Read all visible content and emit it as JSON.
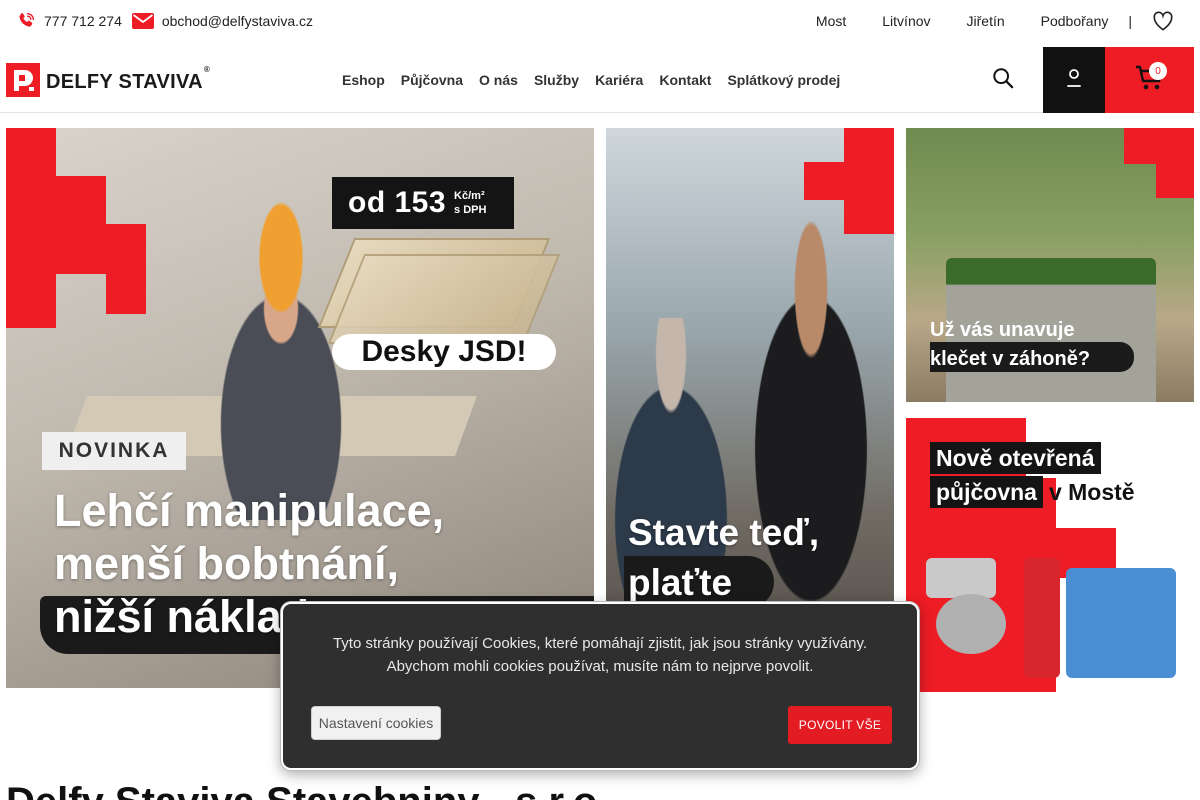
{
  "topbar": {
    "phone": "777 712 274",
    "email": "obchod@delfystaviva.cz",
    "branches": [
      "Most",
      "Litvínov",
      "Jiřetín",
      "Podbořany"
    ],
    "separator": "|"
  },
  "header": {
    "logo_text": "DELFY STAVIVA",
    "logo_reg": "®",
    "nav": [
      "Eshop",
      "Půjčovna",
      "O nás",
      "Služby",
      "Kariéra",
      "Kontakt",
      "Splátkový prodej"
    ],
    "cart_count": "0"
  },
  "banners": {
    "b1": {
      "price_main": "od 153",
      "price_unit_1": "Kč/m²",
      "price_unit_2": "s DPH",
      "product": "Desky JSD!",
      "badge": "NOVINKA",
      "headline": [
        "Lehčí manipulace,",
        "menší bobtnání,",
        "nižší náklady"
      ]
    },
    "b2": {
      "headline": [
        "Stavte teď,",
        "plaťte"
      ]
    },
    "b3": {
      "headline": [
        "Už vás unavuje",
        "klečet v záhoně?"
      ]
    },
    "b4": {
      "line1": "Nově otevřená",
      "line2a": "půjčovna",
      "line2b": "v Mostě"
    }
  },
  "cookie": {
    "text_1": "Tyto stránky používají Cookies, které pomáhají zjistit, jak jsou stránky využívány.",
    "text_2": "Abychom mohli cookies používat, musíte nám to nejprve povolit.",
    "settings_label": "Nastavení cookies",
    "accept_label": "POVOLIT VŠE"
  },
  "bottom_title": "Delfy Staviva Stavebniny - s.r.o.",
  "colors": {
    "brand_red": "#ee1c25",
    "dark": "#111111"
  },
  "icons": {
    "phone": "phone-icon",
    "email": "envelope-icon",
    "heart": "heart-icon",
    "search": "search-icon",
    "account": "user-icon",
    "cart": "cart-icon"
  }
}
